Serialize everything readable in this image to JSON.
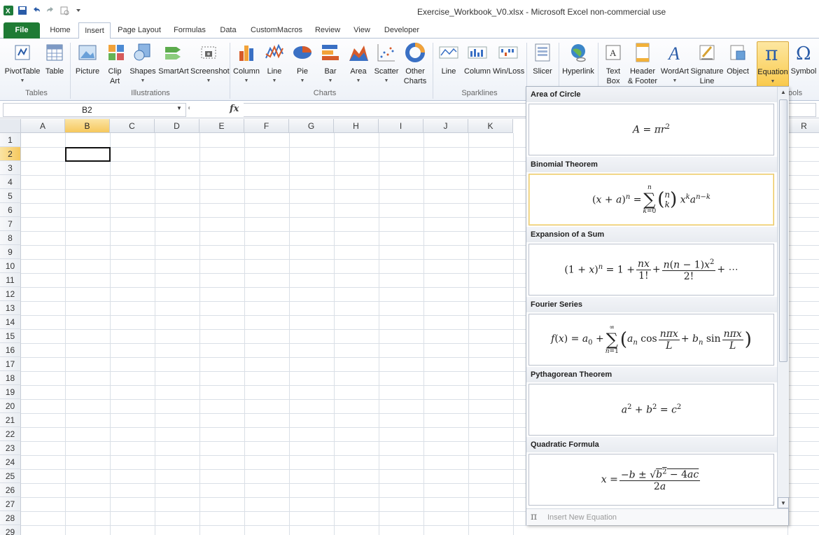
{
  "window": {
    "title": "Exercise_Workbook_V0.xlsx - Microsoft Excel non-commercial use"
  },
  "tabs": [
    "File",
    "Home",
    "Insert",
    "Page Layout",
    "Formulas",
    "Data",
    "CustomMacros",
    "Review",
    "View",
    "Developer"
  ],
  "active_tab": "Insert",
  "ribbon": {
    "tables": {
      "label": "Tables",
      "pivottable": "PivotTable",
      "table": "Table"
    },
    "illustrations": {
      "label": "Illustrations",
      "picture": "Picture",
      "clipart_1": "Clip",
      "clipart_2": "Art",
      "shapes": "Shapes",
      "smartart": "SmartArt",
      "screenshot": "Screenshot"
    },
    "charts": {
      "label": "Charts",
      "column": "Column",
      "line": "Line",
      "pie": "Pie",
      "bar": "Bar",
      "area": "Area",
      "scatter": "Scatter",
      "other_1": "Other",
      "other_2": "Charts"
    },
    "sparklines": {
      "label": "Sparklines",
      "line": "Line",
      "column": "Column",
      "winloss": "Win/Loss"
    },
    "filter": {
      "slicer": "Slicer"
    },
    "links": {
      "hyperlink": "Hyperlink"
    },
    "text": {
      "textbox_1": "Text",
      "textbox_2": "Box",
      "header_1": "Header",
      "header_2": "& Footer",
      "wordart": "WordArt",
      "signature_1": "Signature",
      "signature_2": "Line",
      "object": "Object"
    },
    "symbols": {
      "label_partial": "ools",
      "equation": "Equation",
      "symbol": "Symbol"
    }
  },
  "formula_bar": {
    "name_box": "B2",
    "fx": "fx"
  },
  "grid": {
    "columns": [
      "A",
      "B",
      "C",
      "D",
      "E",
      "F",
      "G",
      "H",
      "I",
      "J",
      "K",
      "R"
    ],
    "rows": [
      "1",
      "2",
      "3",
      "4",
      "5",
      "6",
      "7",
      "8",
      "9",
      "10",
      "11",
      "12",
      "13",
      "14",
      "15",
      "16",
      "17",
      "18",
      "19",
      "20",
      "21",
      "22",
      "23",
      "24",
      "25",
      "26",
      "27",
      "28",
      "29"
    ],
    "selected_cell": "B2"
  },
  "equation_gallery": {
    "sections": [
      {
        "title": "Area of Circle"
      },
      {
        "title": "Binomial Theorem"
      },
      {
        "title": "Expansion of a Sum"
      },
      {
        "title": "Fourier Series"
      },
      {
        "title": "Pythagorean Theorem"
      },
      {
        "title": "Quadratic Formula"
      }
    ],
    "footer_label": "Insert New Equation"
  }
}
